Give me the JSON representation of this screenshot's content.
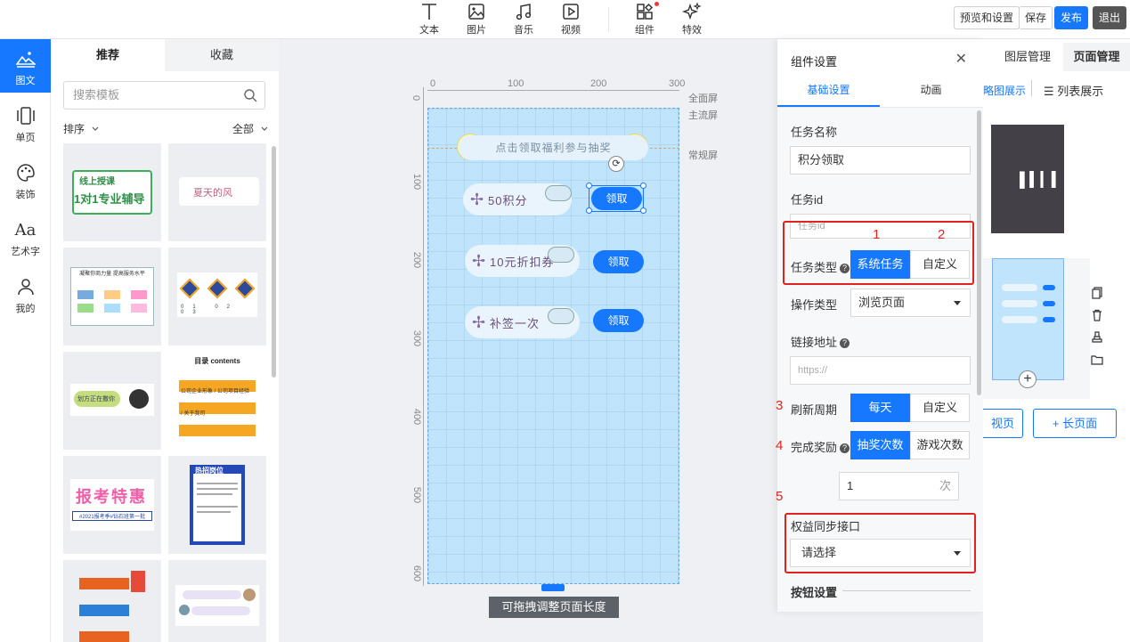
{
  "toolbar": {
    "tools": [
      {
        "label": "文本",
        "icon": "text-icon"
      },
      {
        "label": "图片",
        "icon": "image-icon"
      },
      {
        "label": "音乐",
        "icon": "music-icon"
      },
      {
        "label": "视频",
        "icon": "video-icon"
      },
      {
        "label": "组件",
        "icon": "component-icon"
      },
      {
        "label": "特效",
        "icon": "sparkle-icon"
      }
    ],
    "preview_label": "预览和设置",
    "save_label": "保存",
    "publish_label": "发布",
    "exit_label": "退出"
  },
  "leftnav": {
    "items": [
      {
        "label": "图文",
        "icon": "mountain-icon"
      },
      {
        "label": "单页",
        "icon": "page-icon"
      },
      {
        "label": "装饰",
        "icon": "palette-icon"
      },
      {
        "label": "艺术字",
        "icon": "art-text-icon",
        "glyph": "Aa"
      },
      {
        "label": "我的",
        "icon": "user-icon"
      }
    ]
  },
  "templates": {
    "tabs": [
      "推荐",
      "收藏"
    ],
    "search_placeholder": "搜索模板",
    "sort_label": "排序",
    "filter_label": "全部",
    "items": [
      {
        "title": "线上授课",
        "text": "1对1专业辅导"
      },
      {
        "title": "",
        "text": "夏天的风"
      },
      {
        "title": "凝聚你商力量 提高服务水平",
        "text": ""
      },
      {
        "title": "",
        "text": "01 02 03"
      },
      {
        "title": "",
        "text": "划方正在撒你"
      },
      {
        "title": "目录 contents",
        "text": "公司企业形象 / 公司项目经验 / 关于我司"
      },
      {
        "title": "报考特惠",
        "text": "#2021报考季#钻石班第一批"
      },
      {
        "title": "热招岗位",
        "text": ""
      },
      {
        "title": "",
        "text": ""
      },
      {
        "title": "",
        "text": ""
      }
    ]
  },
  "canvas": {
    "ruler_top": [
      "0",
      "100",
      "200",
      "300"
    ],
    "ruler_left": [
      "0",
      "100",
      "200",
      "300",
      "400",
      "500",
      "600"
    ],
    "screen_labels": [
      "全面屏",
      "主流屏",
      "常规屏"
    ],
    "banner_text": "点击领取福利参与抽奖",
    "tasks": [
      {
        "label": "50积分",
        "button": "领取"
      },
      {
        "label": "10元折扣券",
        "button": "领取"
      },
      {
        "label": "补签一次",
        "button": "领取"
      }
    ],
    "drag_tip": "可拖拽调整页面长度"
  },
  "settings": {
    "title": "组件设置",
    "tabs": [
      "基础设置",
      "动画"
    ],
    "task_name_label": "任务名称",
    "task_name_value": "积分领取",
    "task_id_label": "任务id",
    "task_id_placeholder": "任务id",
    "task_type_label": "任务类型",
    "task_type_options": [
      "系统任务",
      "自定义"
    ],
    "op_type_label": "操作类型",
    "op_type_value": "浏览页面",
    "link_label": "链接地址",
    "link_placeholder": "https://",
    "refresh_label": "刷新周期",
    "refresh_options": [
      "每天",
      "自定义"
    ],
    "reward_label": "完成奖励",
    "reward_options": [
      "抽奖次数",
      "游戏次数"
    ],
    "reward_count": "1",
    "reward_unit": "次",
    "sync_label": "权益同步接口",
    "sync_placeholder": "请选择",
    "button_section": "按钮设置",
    "annotations": [
      "1",
      "2",
      "3",
      "4",
      "5"
    ]
  },
  "rightpanel": {
    "tabs": [
      "图层管理",
      "页面管理"
    ],
    "view_thumb": "略图展示",
    "view_list": "列表展示",
    "add_page": "视页",
    "add_long_page": "+ 长页面"
  },
  "colors": {
    "accent": "#1677ff",
    "annotation": "#e0231f"
  }
}
